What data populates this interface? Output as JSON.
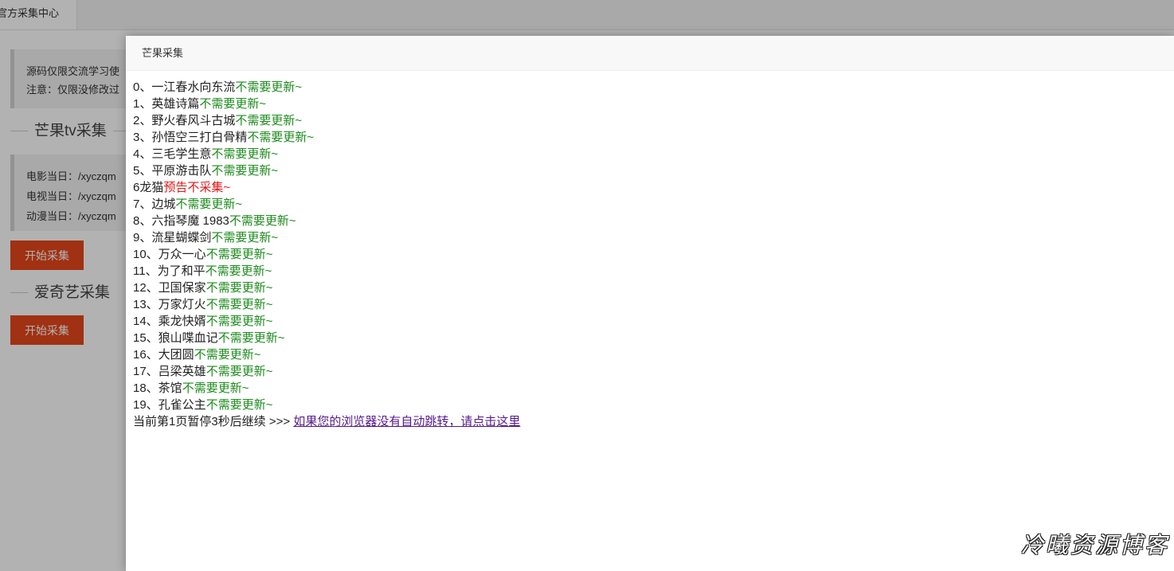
{
  "tabs": [
    "官方采集中心"
  ],
  "notice": {
    "line1": "源码仅限交流学习使",
    "line2": "注意：仅限没修改过"
  },
  "section_mango": "芒果tv采集",
  "collect_info": {
    "movie": "电影当日：/xyczqm",
    "tv": "电视当日：/xyczqm",
    "anime": "动漫当日：/xyczqm"
  },
  "start_button_1": "开始采集",
  "section_iqiyi": "爱奇艺采集",
  "start_button_2": "开始采集",
  "modal": {
    "title": "芒果采集",
    "rows": [
      {
        "label": "0、一江春水向东流",
        "status": "不需要更新~",
        "type": "ok"
      },
      {
        "label": "1、英雄诗篇",
        "status": "不需要更新~",
        "type": "ok"
      },
      {
        "label": "2、野火春风斗古城",
        "status": "不需要更新~",
        "type": "ok"
      },
      {
        "label": "3、孙悟空三打白骨精",
        "status": "不需要更新~",
        "type": "ok"
      },
      {
        "label": "4、三毛学生意",
        "status": "不需要更新~",
        "type": "ok"
      },
      {
        "label": "5、平原游击队",
        "status": "不需要更新~",
        "type": "ok"
      },
      {
        "label": "6龙猫",
        "status": "预告不采集~",
        "type": "warn"
      },
      {
        "label": "7、边城",
        "status": "不需要更新~",
        "type": "ok"
      },
      {
        "label": "8、六指琴魔 1983",
        "status": "不需要更新~",
        "type": "ok"
      },
      {
        "label": "9、流星蝴蝶剑",
        "status": "不需要更新~",
        "type": "ok"
      },
      {
        "label": "10、万众一心",
        "status": "不需要更新~",
        "type": "ok"
      },
      {
        "label": "11、为了和平",
        "status": "不需要更新~",
        "type": "ok"
      },
      {
        "label": "12、卫国保家",
        "status": "不需要更新~",
        "type": "ok"
      },
      {
        "label": "13、万家灯火",
        "status": "不需要更新~",
        "type": "ok"
      },
      {
        "label": "14、乘龙快婿",
        "status": "不需要更新~",
        "type": "ok"
      },
      {
        "label": "15、狼山喋血记",
        "status": "不需要更新~",
        "type": "ok"
      },
      {
        "label": "16、大团圆",
        "status": "不需要更新~",
        "type": "ok"
      },
      {
        "label": "17、吕梁英雄",
        "status": "不需要更新~",
        "type": "ok"
      },
      {
        "label": "18、茶馆",
        "status": "不需要更新~",
        "type": "ok"
      },
      {
        "label": "19、孔雀公主",
        "status": "不需要更新~",
        "type": "ok"
      }
    ],
    "footer_text": "当前第1页暂停3秒后继续 >>> ",
    "footer_link": "如果您的浏览器没有自动跳转，请点击这里"
  },
  "watermark": "冷曦资源博客",
  "colors": {
    "ok": "#1d8a1d",
    "warn": "#e41414",
    "button": "#e6471b",
    "link": "#551a8b"
  }
}
